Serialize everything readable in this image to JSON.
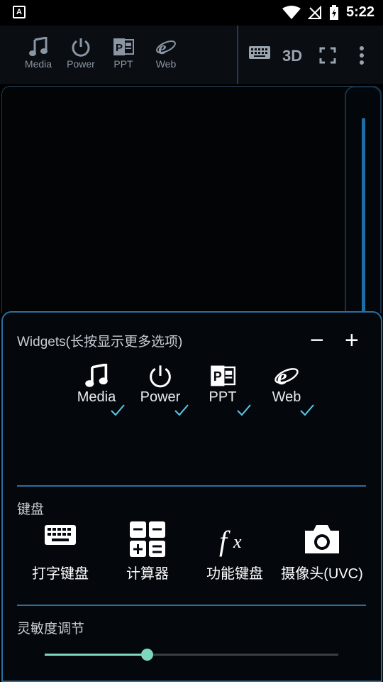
{
  "status_bar": {
    "time": "5:22",
    "app_badge": "A"
  },
  "top_widgets": [
    {
      "label": "Media",
      "icon": "music-note-icon"
    },
    {
      "label": "Power",
      "icon": "power-icon"
    },
    {
      "label": "PPT",
      "icon": "ppt-icon"
    },
    {
      "label": "Web",
      "icon": "ie-icon"
    }
  ],
  "toolbar": {
    "three_d_label": "3D",
    "keyboard_icon": "keyboard-icon",
    "fullscreen_icon": "fullscreen-icon",
    "more_icon": "more-vert-icon"
  },
  "widgets_section": {
    "title": "Widgets(长按显示更多选项)",
    "minus_label": "−",
    "plus_label": "+",
    "items": [
      {
        "label": "Media",
        "checked": true
      },
      {
        "label": "Power",
        "checked": true
      },
      {
        "label": "PPT",
        "checked": true
      },
      {
        "label": "Web",
        "checked": true
      }
    ]
  },
  "keyboard_section": {
    "title": "键盘",
    "items": [
      {
        "label": "打字键盘",
        "icon": "keyboard-icon"
      },
      {
        "label": "计算器",
        "icon": "calculator-icon"
      },
      {
        "label": "功能键盘",
        "icon": "function-fx-icon"
      },
      {
        "label": "摄像头(UVC)",
        "icon": "camera-icon"
      }
    ]
  },
  "sensitivity_section": {
    "title": "灵敏度调节",
    "value_fraction": 0.35
  },
  "colors": {
    "accent": "#2a6fa0",
    "slider": "#7dd6c0",
    "check": "#5bc8e8"
  }
}
